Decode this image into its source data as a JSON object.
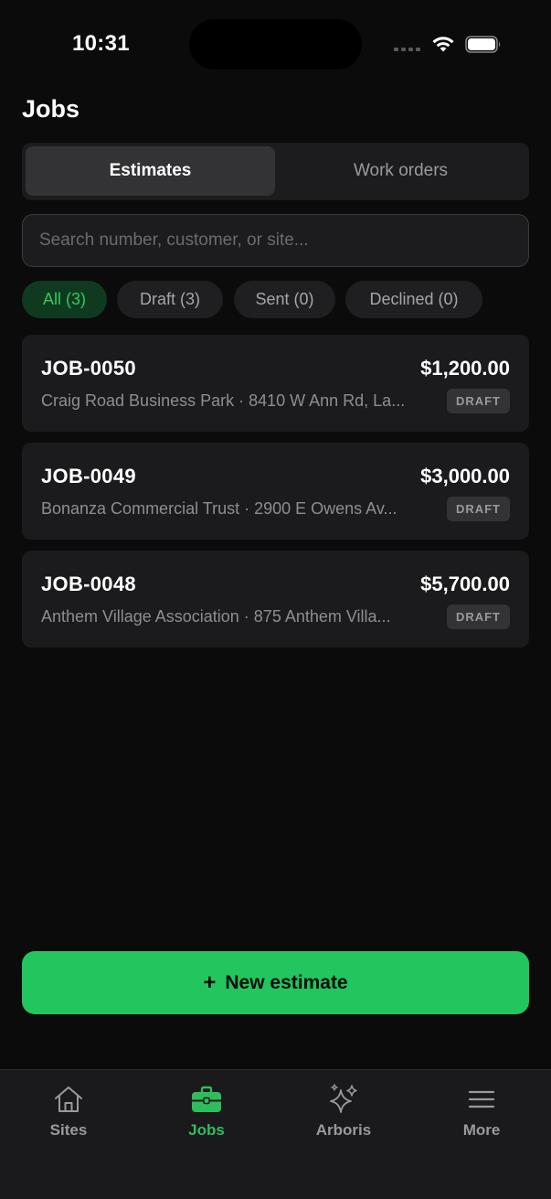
{
  "status_bar": {
    "time": "10:31"
  },
  "page": {
    "title": "Jobs"
  },
  "segments": {
    "estimates": "Estimates",
    "work_orders": "Work orders"
  },
  "search": {
    "placeholder": "Search number, customer, or site..."
  },
  "filters": {
    "all": "All (3)",
    "draft": "Draft (3)",
    "sent": "Sent (0)",
    "declined": "Declined (0)"
  },
  "jobs": [
    {
      "number": "JOB-0050",
      "amount": "$1,200.00",
      "subtitle": "Craig Road Business Park · 8410 W Ann Rd, La...",
      "status": "DRAFT"
    },
    {
      "number": "JOB-0049",
      "amount": "$3,000.00",
      "subtitle": "Bonanza Commercial Trust · 2900 E Owens Av...",
      "status": "DRAFT"
    },
    {
      "number": "JOB-0048",
      "amount": "$5,700.00",
      "subtitle": "Anthem Village Association · 875 Anthem Villa...",
      "status": "DRAFT"
    }
  ],
  "actions": {
    "new_estimate": "New estimate"
  },
  "tabbar": {
    "sites": "Sites",
    "jobs": "Jobs",
    "arboris": "Arboris",
    "more": "More"
  },
  "colors": {
    "accent": "#22c55e",
    "background": "#0b0b0b",
    "card": "#1b1b1d"
  },
  "icons": [
    "wifi-icon",
    "battery-icon",
    "plus-icon",
    "house-icon",
    "briefcase-icon",
    "sparkles-icon",
    "menu-icon"
  ]
}
